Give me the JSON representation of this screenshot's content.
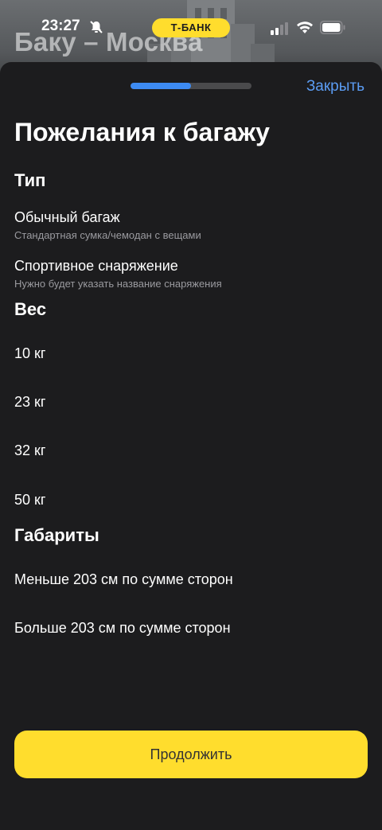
{
  "status_bar": {
    "time": "23:27",
    "bank_label": "Т-БАНК"
  },
  "background": {
    "route_title": "Баку – Москва"
  },
  "sheet": {
    "progress": 0.5,
    "close_label": "Закрыть",
    "title": "Пожелания к багажу"
  },
  "sections": {
    "type": {
      "title": "Тип",
      "options": [
        {
          "label": "Обычный багаж",
          "sub": "Стандартная сумка/чемодан с вещами"
        },
        {
          "label": "Спортивное снаряжение",
          "sub": "Нужно будет указать название снаряжения"
        }
      ]
    },
    "weight": {
      "title": "Вес",
      "options": [
        {
          "label": "10 кг"
        },
        {
          "label": "23 кг"
        },
        {
          "label": "32 кг"
        },
        {
          "label": "50 кг"
        }
      ]
    },
    "dimensions": {
      "title": "Габариты",
      "options": [
        {
          "label": "Меньше 203 см по сумме сторон"
        },
        {
          "label": "Больше 203 см по сумме сторон"
        }
      ]
    }
  },
  "footer": {
    "continue_label": "Продолжить"
  },
  "colors": {
    "accent_yellow": "#ffdd2d",
    "link_blue": "#5b9cf3",
    "progress_blue": "#3d8bf2",
    "sheet_bg": "#1c1c1e",
    "secondary_text": "#9a9a9f"
  },
  "icons": [
    "bell-off-icon",
    "signal-icon",
    "wifi-icon",
    "battery-icon"
  ]
}
